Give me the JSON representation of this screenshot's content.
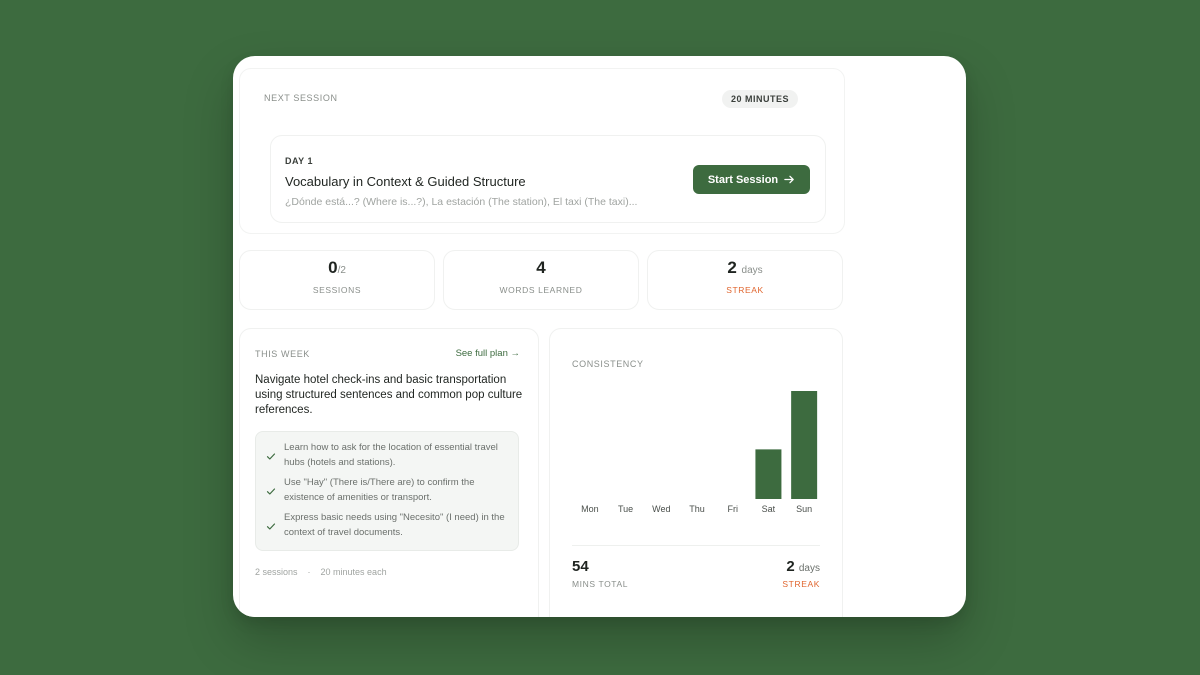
{
  "next_session": {
    "label": "NEXT SESSION",
    "duration": "20 MINUTES",
    "day_label": "DAY 1",
    "title": "Vocabulary in Context & Guided Structure",
    "subtitle": "¿Dónde está...? (Where is...?), La estación (The station), El taxi (The taxi)...",
    "start_label": "Start Session"
  },
  "stats": [
    {
      "value": "0",
      "suffix": "/2",
      "caption": "SESSIONS"
    },
    {
      "value": "4",
      "suffix": "",
      "caption": "WORDS LEARNED"
    },
    {
      "value": "2",
      "suffix": "days",
      "caption": "STREAK"
    }
  ],
  "this_week": {
    "label": "THIS WEEK",
    "see_plan": "See full plan →",
    "title": "Navigate hotel check-ins and basic transportation using structured sentences and common pop culture references.",
    "goals": [
      "Learn how to ask for the location of essential travel hubs (hotels and stations).",
      "Use \"Hay\" (There is/There are) to confirm the existence of amenities or transport.",
      "Express basic needs using \"Necesito\" (I need) in the context of travel documents."
    ],
    "foot_sessions": "2 sessions",
    "foot_sep": "·",
    "foot_duration": "20 minutes each"
  },
  "consistency": {
    "label": "CONSISTENCY",
    "mins_total": "54",
    "mins_caption": "MINS TOTAL",
    "streak_value": "2",
    "streak_unit": "days",
    "streak_caption": "STREAK"
  },
  "chart_data": {
    "type": "bar",
    "categories": [
      "Mon",
      "Tue",
      "Wed",
      "Thu",
      "Fri",
      "Sat",
      "Sun"
    ],
    "values": [
      0,
      0,
      0,
      0,
      0,
      17,
      37
    ],
    "ylim": [
      0,
      37
    ],
    "grid": false,
    "color": "#3d6b3f"
  },
  "colors": {
    "background": "#3d6b3f",
    "accent": "#3d6b3f",
    "streak": "#e0662f"
  }
}
